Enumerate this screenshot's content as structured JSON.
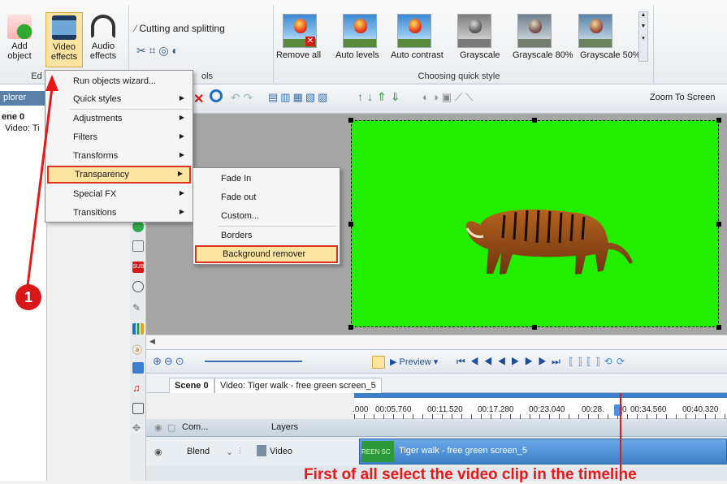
{
  "ribbon": {
    "add_object": "Add object",
    "video_effects": "Video effects",
    "audio_effects": "Audio effects",
    "edit_group": "Ed",
    "tools_group": "ols",
    "cutting": "Cutting and splitting",
    "quick_style_group": "Choosing quick style",
    "styles": [
      "Remove all",
      "Auto levels",
      "Auto contrast",
      "Grayscale",
      "Grayscale 80%",
      "Grayscale 50%"
    ]
  },
  "explorer": {
    "header": "plorer",
    "scene": "ene 0",
    "video": "Video: Ti"
  },
  "toolbar": {
    "zoom_label": "Zoom To Screen"
  },
  "menu_main": {
    "items": [
      "Run objects wizard...",
      "Quick styles",
      "Adjustments",
      "Filters",
      "Transforms",
      "Transparency",
      "Special FX",
      "Transitions"
    ]
  },
  "menu_sub": {
    "items": [
      "Fade In",
      "Fade out",
      "Custom...",
      "Borders",
      "Background remover"
    ]
  },
  "timeline": {
    "preview_label": "Preview",
    "tab_scene": "Scene 0",
    "tab_video": "Video: Tiger walk - free green screen_5",
    "ticks": [
      ".000",
      "00:05.760",
      "00:11.520",
      "00:17.280",
      "00:23.040",
      "00:28.",
      "0",
      "00:34.560",
      "00:40.320"
    ],
    "layers_label": "Layers",
    "com_label": "Com...",
    "blend_label": "Blend",
    "video_label": "Video",
    "clip_label": "Tiger walk - free green screen_5",
    "clip_thumb_text": "REEN SC"
  },
  "annotation": {
    "badge": "1",
    "caption": "First of all select the video clip in the timeline"
  },
  "colors": {
    "green_screen": "#22ee00",
    "highlight_red": "#e81818",
    "menu_highlight": "#fbe3a2"
  }
}
